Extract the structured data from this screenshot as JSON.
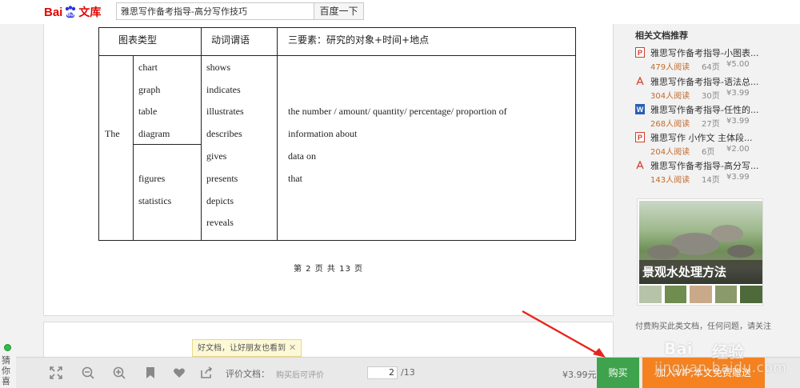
{
  "header": {
    "logo_bai": "Bai",
    "logo_du": "du",
    "logo_wenku": "文库",
    "search_value": "雅思写作备考指导-高分写作技巧",
    "search_button": "百度一下"
  },
  "document": {
    "table": {
      "headers": [
        "图表类型",
        "动词谓语",
        "三要素：研究的对象+时间+地点"
      ],
      "subject": "The",
      "chart_types_group1": [
        "chart",
        "graph",
        "table",
        "diagram"
      ],
      "chart_types_group2": [
        "figures",
        "statistics"
      ],
      "verbs": [
        "shows",
        "indicates",
        "illustrates",
        "describes",
        "gives",
        "presents",
        "depicts",
        "reveals"
      ],
      "elements": [
        "the number / amount/ quantity/ percentage/ proportion of",
        "information about",
        "data on",
        "that"
      ]
    },
    "page_footer": "第 2 页 共 13 页"
  },
  "sidebar": {
    "title": "相关文档推荐",
    "items": [
      {
        "icon": "P",
        "type": "ppt",
        "title": "雅思写作备考指导-小图表...",
        "reads": "479人阅读",
        "pages": "64页",
        "price": "¥5.00"
      },
      {
        "icon": "pdf",
        "type": "pdf",
        "title": "雅思写作备考指导-语法总...",
        "reads": "304人阅读",
        "pages": "30页",
        "price": "¥3.99"
      },
      {
        "icon": "W",
        "type": "word",
        "title": "雅思写作备考指导-任性的...",
        "reads": "268人阅读",
        "pages": "27页",
        "price": "¥3.99"
      },
      {
        "icon": "P",
        "type": "ppt",
        "title": "雅思写作 小作文 主体段...",
        "reads": "204人阅读",
        "pages": "6页",
        "price": "¥2.00"
      },
      {
        "icon": "pdf",
        "type": "pdf",
        "title": "雅思写作备考指导-高分写...",
        "reads": "143人阅读",
        "pages": "14页",
        "price": "¥3.99"
      }
    ],
    "ad_caption": "景观水处理方法",
    "note": "付费购买此类文档，任何问题，请关注"
  },
  "left_float": {
    "guess_label": "猜你喜"
  },
  "tooltip": {
    "text": "好文档，让好朋友也看到",
    "close": "✕"
  },
  "toolbar": {
    "rate_label": "评价文档：",
    "rate_hint": "购买后可评价",
    "current_page": "2",
    "total_pages": "/13",
    "price": "¥3.99元",
    "buy_label": "购买",
    "vip_label": "加入VIP,本文免费赠送"
  },
  "watermark": {
    "brand": "Bai",
    "cn": "经验",
    "url": "jingyan.baidu.com"
  },
  "colors": {
    "brand_red": "#e10601",
    "buy_green": "#3fa34d",
    "vip_orange": "#f5821f",
    "reads_orange": "#c36a2d"
  }
}
